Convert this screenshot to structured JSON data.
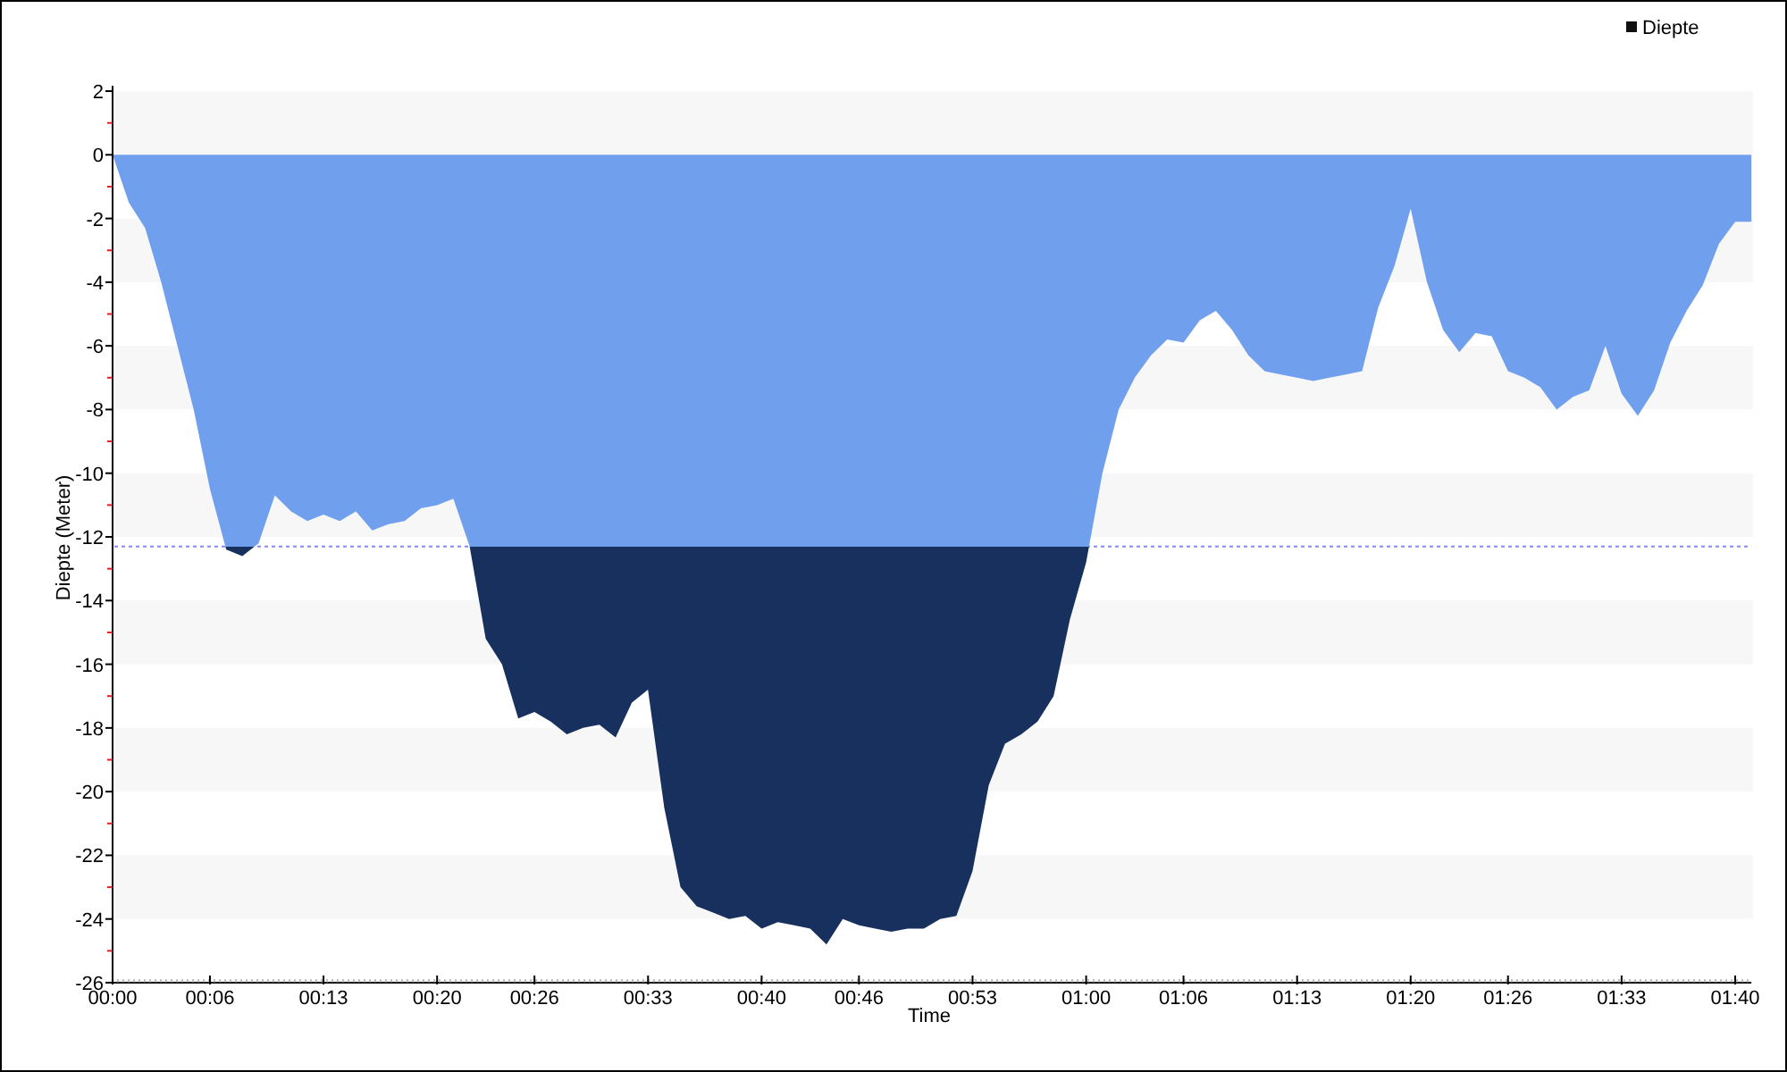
{
  "chart_data": {
    "type": "area",
    "xlabel": "Time",
    "ylabel": "Diepte (Meter)",
    "x": [
      0,
      1,
      2,
      3,
      4,
      5,
      6,
      7,
      8,
      9,
      10,
      11,
      12,
      13,
      14,
      15,
      16,
      17,
      18,
      19,
      20,
      21,
      22,
      23,
      24,
      25,
      26,
      27,
      28,
      29,
      30,
      31,
      32,
      33,
      34,
      35,
      36,
      37,
      38,
      39,
      40,
      41,
      42,
      43,
      44,
      45,
      46,
      47,
      48,
      49,
      50,
      51,
      52,
      53,
      54,
      55,
      56,
      57,
      58,
      59,
      60,
      61,
      62,
      63,
      64,
      65,
      66,
      67,
      68,
      69,
      70,
      71,
      72,
      73,
      74,
      75,
      76,
      77,
      78,
      79,
      80,
      81,
      82,
      83,
      84,
      85,
      86,
      87,
      88,
      89,
      90,
      91,
      92,
      93,
      94,
      95,
      96,
      97,
      98,
      99,
      100,
      101
    ],
    "series": [
      {
        "name": "Diepte",
        "color": "#6f9fed",
        "values": [
          0,
          -1.5,
          -2.3,
          -4,
          -6,
          -8,
          -10.5,
          -12.4,
          -12.6,
          -12.2,
          -10.7,
          -11.2,
          -11.5,
          -11.3,
          -11.5,
          -11.2,
          -11.8,
          -11.6,
          -11.5,
          -11.1,
          -11,
          -10.8,
          -12.3,
          -15.2,
          -16,
          -17.7,
          -17.5,
          -17.8,
          -18.2,
          -18,
          -17.9,
          -18.3,
          -17.2,
          -16.8,
          -20.5,
          -23,
          -23.6,
          -23.8,
          -24,
          -23.9,
          -24.3,
          -24.1,
          -24.2,
          -24.3,
          -24.8,
          -24,
          -24.2,
          -24.3,
          -24.4,
          -24.3,
          -24.3,
          -24,
          -23.9,
          -22.5,
          -19.8,
          -18.5,
          -18.2,
          -17.8,
          -17,
          -14.6,
          -12.8,
          -10,
          -8,
          -7,
          -6.3,
          -5.8,
          -5.9,
          -5.2,
          -4.9,
          -5.5,
          -6.3,
          -6.8,
          -6.9,
          -7,
          -7.1,
          -7,
          -6.9,
          -6.8,
          -4.8,
          -3.5,
          -1.7,
          -4,
          -5.5,
          -6.2,
          -5.6,
          -5.7,
          -6.8,
          -7,
          -7.3,
          -8,
          -7.6,
          -7.4,
          -6,
          -7.5,
          -8.2,
          -7.4,
          -5.9,
          -4.9,
          -4.1,
          -2.8,
          -2.1,
          -2.1
        ]
      }
    ],
    "xlim": [
      0,
      101
    ],
    "ylim": [
      -26,
      2
    ],
    "xticks": [
      {
        "value": 0,
        "label": "00:00"
      },
      {
        "value": 6,
        "label": "00:06"
      },
      {
        "value": 13,
        "label": "00:13"
      },
      {
        "value": 20,
        "label": "00:20"
      },
      {
        "value": 26,
        "label": "00:26"
      },
      {
        "value": 33,
        "label": "00:33"
      },
      {
        "value": 40,
        "label": "00:40"
      },
      {
        "value": 46,
        "label": "00:46"
      },
      {
        "value": 53,
        "label": "00:53"
      },
      {
        "value": 60,
        "label": "01:00"
      },
      {
        "value": 66,
        "label": "01:06"
      },
      {
        "value": 73,
        "label": "01:13"
      },
      {
        "value": 80,
        "label": "01:20"
      },
      {
        "value": 86,
        "label": "01:26"
      },
      {
        "value": 93,
        "label": "01:33"
      },
      {
        "value": 100,
        "label": "01:40"
      }
    ],
    "yticks": [
      2,
      0,
      -2,
      -4,
      -6,
      -8,
      -10,
      -12,
      -14,
      -16,
      -18,
      -20,
      -22,
      -24,
      -26
    ],
    "ref_lines": [
      {
        "axis": "y",
        "value": -12.3,
        "color": "#8888ee"
      }
    ]
  }
}
